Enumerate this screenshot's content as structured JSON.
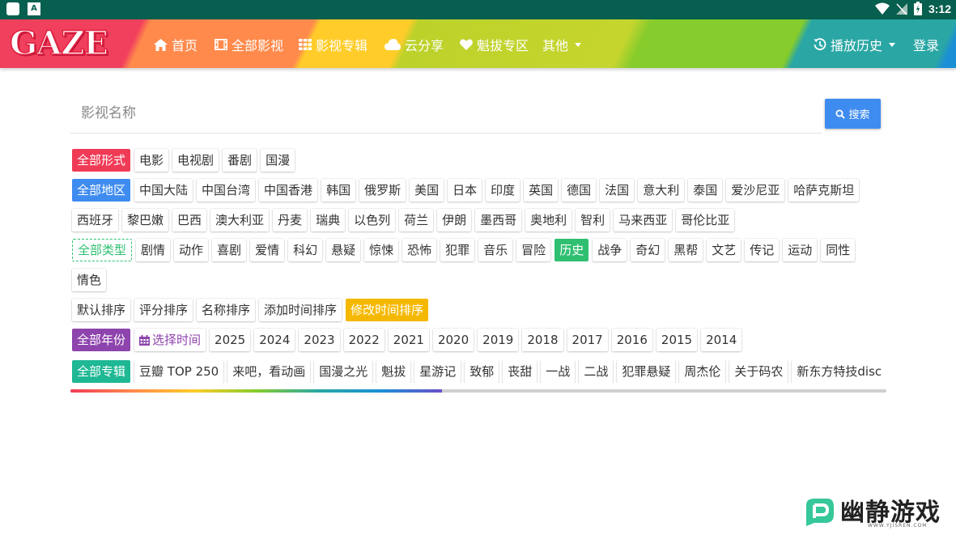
{
  "status_bar": {
    "time": "3:12"
  },
  "nav": {
    "logo": "GAZE",
    "items": [
      {
        "label": "首页",
        "icon": "home-icon"
      },
      {
        "label": "全部影视",
        "icon": "film-icon"
      },
      {
        "label": "影视专辑",
        "icon": "grid-icon"
      },
      {
        "label": "云分享",
        "icon": "cloud-icon"
      },
      {
        "label": "魁拔专区",
        "icon": "heart-icon"
      },
      {
        "label": "其他",
        "icon": "chevron-down-icon"
      }
    ],
    "history": "播放历史",
    "login": "登录"
  },
  "search": {
    "placeholder": "影视名称",
    "button": "搜索"
  },
  "filters": {
    "form": [
      "全部形式",
      "电影",
      "电视剧",
      "番剧",
      "国漫"
    ],
    "region_row1": [
      "全部地区",
      "中国大陆",
      "中国台湾",
      "中国香港",
      "韩国",
      "俄罗斯",
      "美国",
      "日本",
      "印度",
      "英国",
      "德国",
      "法国",
      "意大利",
      "泰国",
      "爱沙尼亚",
      "哈萨克斯坦"
    ],
    "region_row2": [
      "西班牙",
      "黎巴嫩",
      "巴西",
      "澳大利亚",
      "丹麦",
      "瑞典",
      "以色列",
      "荷兰",
      "伊朗",
      "墨西哥",
      "奥地利",
      "智利",
      "马来西亚",
      "哥伦比亚"
    ],
    "genre_row1": [
      "全部类型",
      "剧情",
      "动作",
      "喜剧",
      "爱情",
      "科幻",
      "悬疑",
      "惊悚",
      "恐怖",
      "犯罪",
      "音乐",
      "冒险",
      "历史",
      "战争",
      "奇幻",
      "黑帮",
      "文艺",
      "传记",
      "运动",
      "同性"
    ],
    "genre_row2": [
      "情色"
    ],
    "sort": [
      "默认排序",
      "评分排序",
      "名称排序",
      "添加时间排序",
      "修改时间排序"
    ],
    "year": [
      "全部年份",
      "选择时间",
      "2025",
      "2024",
      "2023",
      "2022",
      "2021",
      "2020",
      "2019",
      "2018",
      "2017",
      "2016",
      "2015",
      "2014"
    ],
    "album": [
      "全部专辑",
      "豆瓣 TOP 250",
      "来吧，看动画",
      "国漫之光",
      "魁拔",
      "星游记",
      "致郁",
      "丧甜",
      "一战",
      "二战",
      "犯罪悬疑",
      "周杰伦",
      "关于码农",
      "新东方特技disc"
    ]
  },
  "scroll_progress": 0.455,
  "colors": {
    "accent_red": "#f03b56",
    "accent_blue": "#3f8cf0",
    "accent_green": "#2fbf71",
    "accent_yellow": "#f5b800",
    "accent_purple": "#8e44ad",
    "accent_teal": "#1fb894"
  },
  "watermark": {
    "text": "幽静游戏",
    "sub": "WWW.YJISREN.COM"
  }
}
